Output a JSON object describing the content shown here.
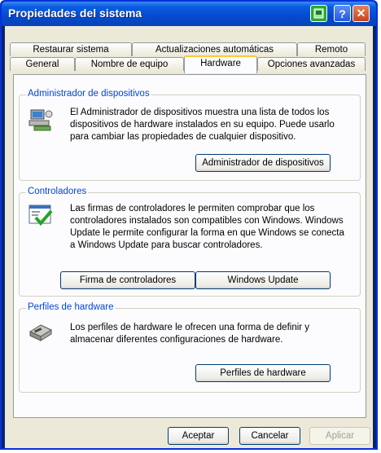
{
  "window": {
    "title": "Propiedades del sistema"
  },
  "tabs_row1": [
    "Restaurar sistema",
    "Actualizaciones automáticas",
    "Remoto"
  ],
  "tabs_row2": [
    "General",
    "Nombre de equipo",
    "Hardware",
    "Opciones avanzadas"
  ],
  "device_manager": {
    "title": "Administrador de dispositivos",
    "description": "El Administrador de dispositivos muestra una lista de todos los dispositivos de hardware instalados en su equipo. Puede usarlo para cambiar las propiedades de cualquier dispositivo.",
    "button": "Administrador de dispositivos"
  },
  "drivers": {
    "title": "Controladores",
    "description": "Las firmas de controladores le permiten comprobar que los controladores instalados son compatibles con Windows. Windows Update le permite configurar la forma en que Windows se conecta a Windows Update para buscar controladores.",
    "button_signing": "Firma de controladores",
    "button_update": "Windows Update"
  },
  "profiles": {
    "title": "Perfiles de hardware",
    "description": "Los perfiles de hardware le ofrecen una forma de definir y almacenar diferentes configuraciones de hardware.",
    "button": "Perfiles de hardware"
  },
  "footer": {
    "ok": "Aceptar",
    "cancel": "Cancelar",
    "apply": "Aplicar"
  }
}
